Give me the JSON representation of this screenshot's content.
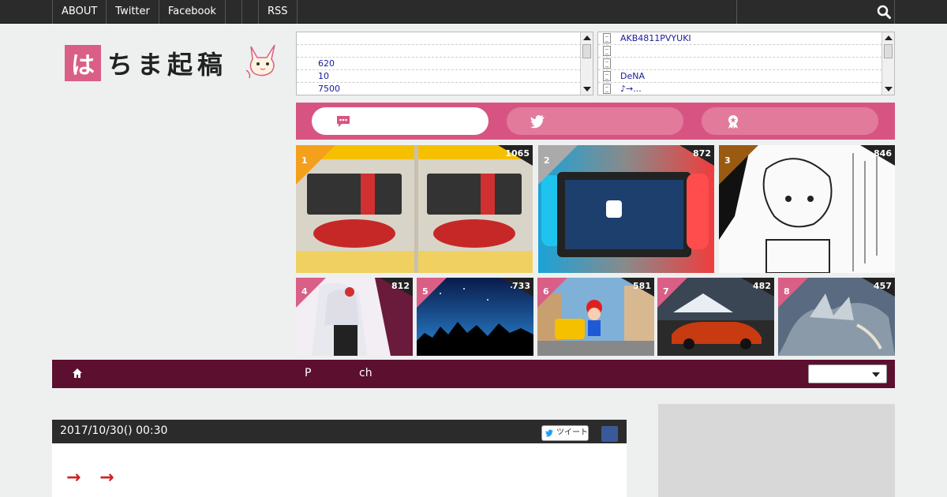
{
  "topnav": {
    "items": [
      "ABOUT",
      "Twitter",
      "Facebook",
      "",
      "",
      "RSS"
    ]
  },
  "logo": {
    "first_char": "は",
    "rest": "ちま起稿"
  },
  "rss_left": {
    "rows": [
      "",
      "",
      "620",
      "10",
      "7500"
    ]
  },
  "rss_right": {
    "rows": [
      "AKB4811PVYUKI",
      "",
      "",
      "DeNA",
      "♪→..."
    ]
  },
  "tabs": [
    {
      "icon": "speech-bubble-icon",
      "active": true
    },
    {
      "icon": "twitter-bird-icon",
      "active": false
    },
    {
      "icon": "medal-icon",
      "active": false
    }
  ],
  "ranking": [
    {
      "rank": "1",
      "count": "1065",
      "corner": "#f4a01c"
    },
    {
      "rank": "2",
      "count": "872",
      "corner": "#aaaaaa"
    },
    {
      "rank": "3",
      "count": "846",
      "corner": "#9a5a12"
    },
    {
      "rank": "4",
      "count": "812",
      "corner": "#d95f86"
    },
    {
      "rank": "5",
      "count": "733",
      "corner": "#d95f86"
    },
    {
      "rank": "6",
      "count": "581",
      "corner": "#d95f86"
    },
    {
      "rank": "7",
      "count": "482",
      "corner": "#d95f86"
    },
    {
      "rank": "8",
      "count": "457",
      "corner": "#d95f86"
    }
  ],
  "darknav": {
    "p": "P",
    "ch": "ch"
  },
  "article": {
    "date": "2017/10/30() 00:30",
    "tweet": "ツイート",
    "arrows": "→ →"
  },
  "colors": {
    "accent_pink": "#d75482",
    "dark_nav": "#5c0f2f",
    "top_bar": "#2b2b2b"
  }
}
